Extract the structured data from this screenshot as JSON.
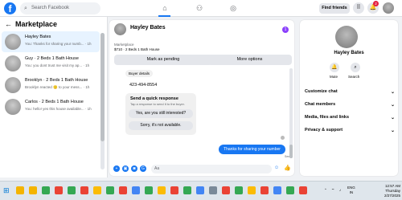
{
  "topbar": {
    "logo": "f",
    "search_placeholder": "Search Facebook",
    "find_friends": "Find friends",
    "notification_count": "2"
  },
  "sidebar": {
    "title": "Marketplace",
    "threads": [
      {
        "name": "Hayley Bates",
        "preview": "You: Thanks for sharing your numb... · 1h"
      },
      {
        "name": "Guy · 2 Beds 1 Bath House",
        "preview": "You: you dont trust me visit my ap... · 1h"
      },
      {
        "name": "Brooklyn · 2 Beds 1 Bath House",
        "preview": "Brooklyn reacted 🙂 to your mess... · 1h"
      },
      {
        "name": "Carlos · 2 Beds 1 Bath House",
        "preview": "You: hello! yes this house available... · 1h"
      }
    ]
  },
  "chat": {
    "contact_name": "Hayley Bates",
    "badge": "1",
    "marketplace_label": "Marketplace",
    "item": "$710 · 2 Beds 1 Bath House",
    "mark_pending": "Mark as pending",
    "more_options": "More options",
    "buyer_details": "Buyer details",
    "phone": "423-494-8554",
    "quick_title": "Send a quick response",
    "quick_sub": "Tap a response to send it to the buyer.",
    "quick_options": [
      "Yes, are you still interested?",
      "Sorry, it's not available."
    ],
    "outgoing_message": "Thanks for sharing your number",
    "sent_label": "Sent",
    "composer_placeholder": "Aa"
  },
  "right_panel": {
    "name": "Hayley Bates",
    "mute": "Mute",
    "search": "Search",
    "sections": [
      "Customize chat",
      "Chat members",
      "Media, files and links",
      "Privacy & support"
    ]
  },
  "taskbar": {
    "lang": "ENG",
    "lang_sub": "IN",
    "time": "12:57 AM",
    "day": "Thursday",
    "date": "2/27/2025"
  }
}
